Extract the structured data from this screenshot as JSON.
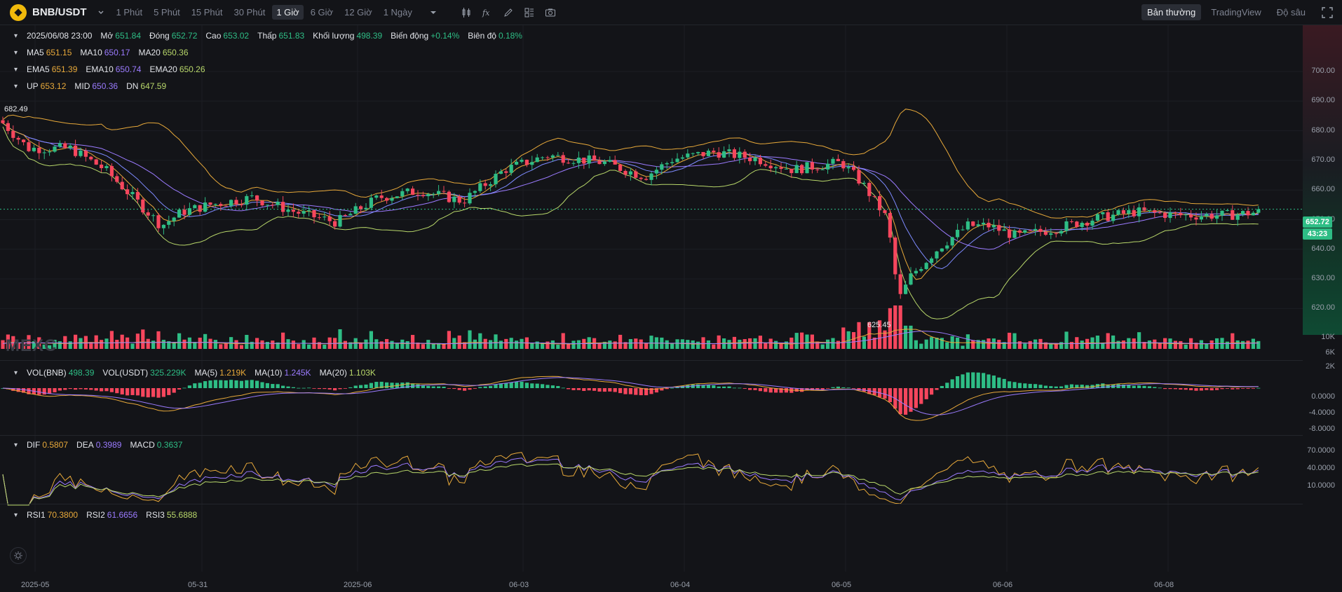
{
  "toolbar": {
    "pair": "BNB/USDT",
    "intervals": [
      "1 Phút",
      "5 Phút",
      "15 Phút",
      "30 Phút",
      "1 Giờ",
      "6 Giờ",
      "12 Giờ",
      "1 Ngày"
    ],
    "active_interval": "1 Giờ",
    "views": [
      "Bản thường",
      "TradingView",
      "Độ sâu"
    ],
    "active_view": "Bản thường"
  },
  "ohlc": {
    "date": "2025/06/08 23:00",
    "open_label": "Mở",
    "open": "651.84",
    "close_label": "Đóng",
    "close": "652.72",
    "high_label": "Cao",
    "high": "653.02",
    "low_label": "Thấp",
    "low": "651.83",
    "volume_label": "Khối lượng",
    "volume": "498.39",
    "change_label": "Biến động",
    "change": "+0.14%",
    "amp_label": "Biên độ",
    "amp": "0.18%"
  },
  "ma": {
    "ma5_label": "MA5",
    "ma5": "651.15",
    "ma10_label": "MA10",
    "ma10": "650.17",
    "ma20_label": "MA20",
    "ma20": "650.36"
  },
  "ema": {
    "ema5_label": "EMA5",
    "ema5": "651.39",
    "ema10_label": "EMA10",
    "ema10": "650.74",
    "ema20_label": "EMA20",
    "ema20": "650.26"
  },
  "boll": {
    "up_label": "UP",
    "up": "653.12",
    "mid_label": "MID",
    "mid": "650.36",
    "dn_label": "DN",
    "dn": "647.59"
  },
  "volume_pane": {
    "vol_bnb_label": "VOL(BNB)",
    "vol_bnb": "498.39",
    "vol_usdt_label": "VOL(USDT)",
    "vol_usdt": "325.229K",
    "ma5_label": "MA(5)",
    "ma5": "1.219K",
    "ma10_label": "MA(10)",
    "ma10": "1.245K",
    "ma20_label": "MA(20)",
    "ma20": "1.103K",
    "axis": [
      "10K",
      "6K",
      "2K"
    ]
  },
  "macd_pane": {
    "dif_label": "DIF",
    "dif": "0.5807",
    "dea_label": "DEA",
    "dea": "0.3989",
    "macd_label": "MACD",
    "macd": "0.3637",
    "axis": [
      "0.0000",
      "-4.0000",
      "-8.0000"
    ]
  },
  "rsi_pane": {
    "rsi1_label": "RSI1",
    "rsi1": "70.3800",
    "rsi2_label": "RSI2",
    "rsi2": "61.6656",
    "rsi3_label": "RSI3",
    "rsi3": "55.6888",
    "axis": [
      "70.0000",
      "40.0000",
      "10.0000"
    ]
  },
  "price_axis": [
    "700.00",
    "690.00",
    "680.00",
    "670.00",
    "660.00",
    "650.00",
    "640.00",
    "630.00",
    "620.00"
  ],
  "time_axis": [
    "2025-05",
    "05-31",
    "2025-06",
    "06-03",
    "06-04",
    "06-05",
    "06-06",
    "06-08"
  ],
  "current_price": "652.72",
  "countdown": "43:23",
  "high_marker": "682.49",
  "low_marker": "625.45",
  "watermark": "MEXC",
  "colors": {
    "up": "#2ebd85",
    "down": "#f6465d",
    "ma5": "#e8a93a",
    "ma10": "#9b7bff",
    "ma20": "#b8d76a",
    "background": "#131418"
  },
  "chart_data": {
    "type": "candlestick",
    "symbol": "BNB/USDT",
    "interval": "1 Giờ",
    "price_range": [
      617,
      705
    ],
    "approx_close_path": [
      [
        "2025-05",
        676
      ],
      [
        "05-31",
        653
      ],
      [
        "2025-06",
        653
      ],
      [
        "06-03",
        666
      ],
      [
        "06-04",
        663
      ],
      [
        "06-05",
        664
      ],
      [
        "06-05",
        626
      ],
      [
        "06-06",
        645
      ],
      [
        "06-08",
        652.72
      ]
    ],
    "high_marker": 682.49,
    "low_marker": 625.45
  }
}
